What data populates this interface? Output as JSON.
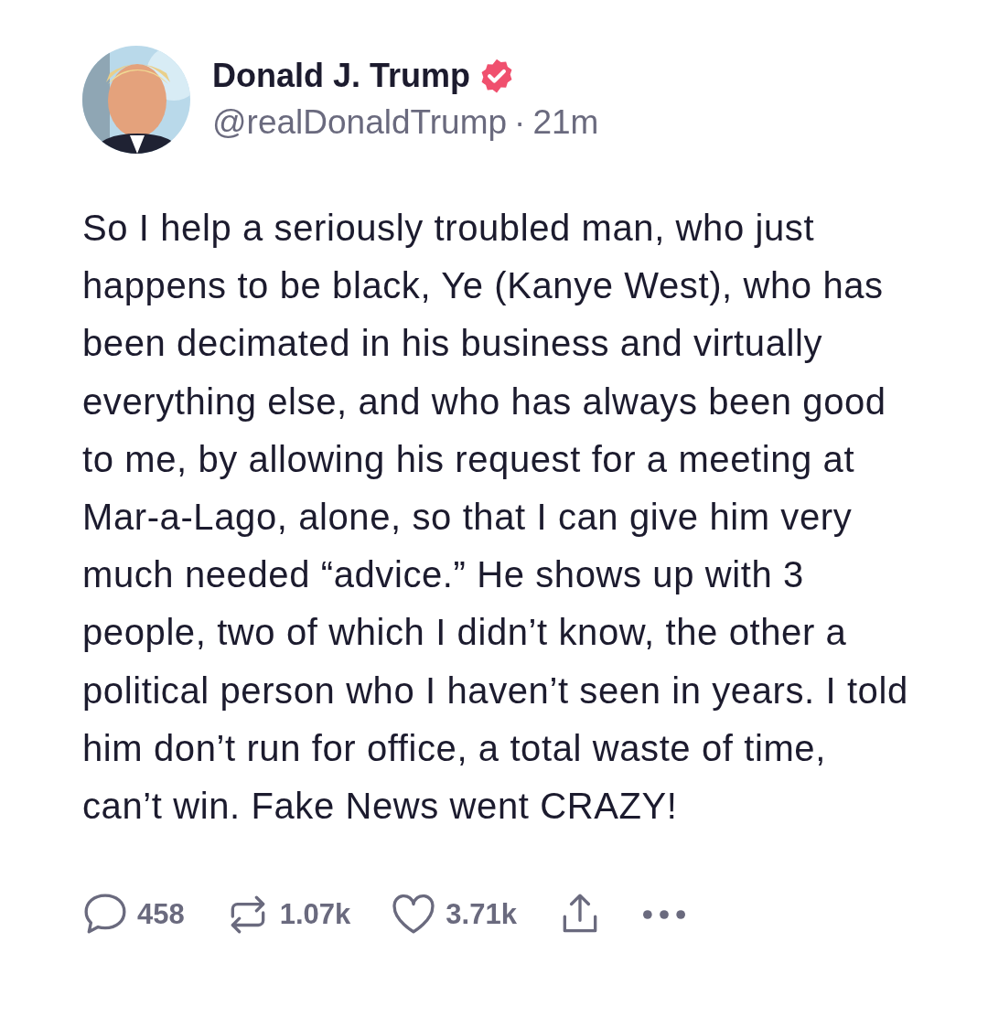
{
  "post": {
    "author": {
      "name": "Donald J. Trump",
      "verified": true,
      "handle": "@realDonaldTrump",
      "separator": "·",
      "time": "21m"
    },
    "text": "So I help a seriously troubled man, who just happens to be black, Ye (Kanye West), who has been decimated in his business and virtually everything else, and who has always been good to me, by allowing his request for a meeting at Mar-a-Lago, alone, so that I can give him very much needed “advice.” He shows up with 3 people, two of which I didn’t know, the other a political person who I haven’t seen in years. I told him don’t run for office, a total waste of time, can’t win. Fake News went CRAZY!",
    "actions": [
      {
        "kind": "reply",
        "count": "458"
      },
      {
        "kind": "repost",
        "count": "1.07k"
      },
      {
        "kind": "like",
        "count": "3.71k"
      },
      {
        "kind": "share"
      },
      {
        "kind": "more"
      }
    ]
  }
}
